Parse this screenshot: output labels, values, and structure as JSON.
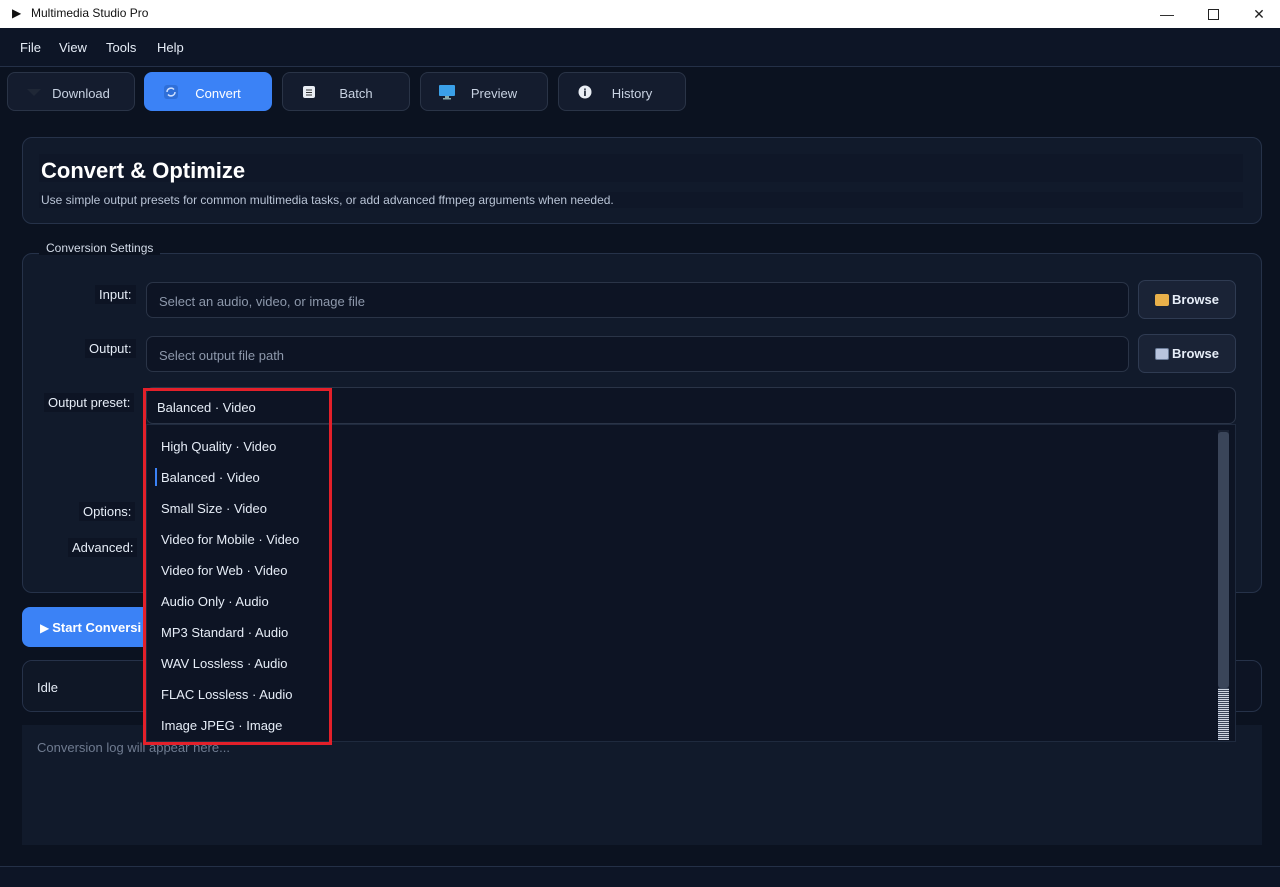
{
  "window": {
    "title": "Multimedia Studio Pro"
  },
  "menu": [
    "File",
    "View",
    "Tools",
    "Help"
  ],
  "tabs": [
    {
      "label": "Download",
      "icon": "download-arrow-icon",
      "active": false
    },
    {
      "label": "Convert",
      "icon": "convert-icon",
      "active": true
    },
    {
      "label": "Batch",
      "icon": "batch-list-icon",
      "active": false
    },
    {
      "label": "Preview",
      "icon": "monitor-icon",
      "active": false
    },
    {
      "label": "History",
      "icon": "info-icon",
      "active": false
    }
  ],
  "header": {
    "title": "Convert & Optimize",
    "subtitle": "Use simple output presets for common multimedia tasks, or add advanced ffmpeg arguments when needed."
  },
  "settings": {
    "group_title": "Conversion Settings",
    "input_label": "Input:",
    "input_placeholder": "Select an audio, video, or image file",
    "output_label": "Output:",
    "output_placeholder": "Select output file path",
    "browse_label": "Browse",
    "preset_label": "Output preset:",
    "preset_selected": "Balanced  ·  Video",
    "options_label": "Options:",
    "advanced_label": "Advanced:",
    "preset_options": [
      "High Quality  ·  Video",
      "Balanced  ·  Video",
      "Small Size  ·  Video",
      "Video for Mobile  ·  Video",
      "Video for Web  ·  Video",
      "Audio Only  ·  Audio",
      "MP3 Standard  ·  Audio",
      "WAV Lossless  ·  Audio",
      "FLAC Lossless  ·  Audio",
      "Image JPEG  ·  Image"
    ]
  },
  "actions": {
    "start_label": "Start Conversi"
  },
  "status": {
    "text": "Idle"
  },
  "log": {
    "placeholder": "Conversion log will appear here..."
  },
  "colors": {
    "accent": "#3b82f6",
    "highlight": "#e3202a",
    "background": "#0b1220"
  }
}
